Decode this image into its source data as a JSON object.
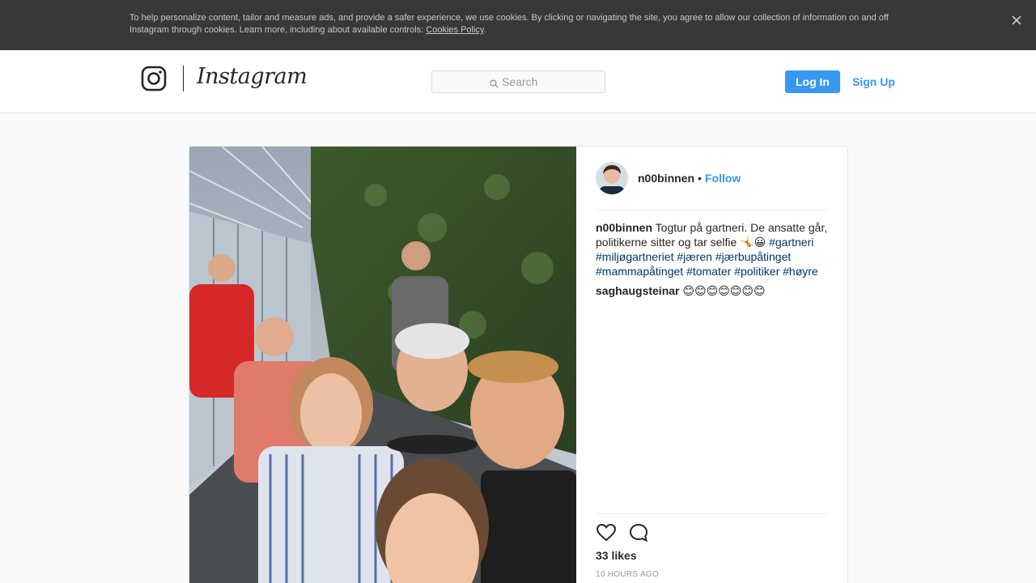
{
  "cookie_banner": {
    "text": "To help personalize content, tailor and measure ads, and provide a safer experience, we use cookies. By clicking or navigating the site, you agree to allow our collection of information on and off Instagram through cookies. Learn more, including about available controls: ",
    "link_label": "Cookies Policy",
    "trailing": ".",
    "close_icon": "close-icon"
  },
  "header": {
    "logo_text": "Instagram",
    "logo_icon": "instagram-glyph-icon",
    "search_placeholder": "Search",
    "login_label": "Log In",
    "signup_label": "Sign Up"
  },
  "post": {
    "author": "n00binnen",
    "separator": "•",
    "follow_label": "Follow",
    "caption_user": "n00binnen",
    "caption_text": " Togtur på gartneri. De ansatte går, politikerne sitter og tar selfie 🤸😀 ",
    "hashtags": [
      "#gartneri",
      "#miljøgartneriet",
      "#jæren",
      "#jærbupåtinget",
      "#mammapåtinget",
      "#tomater",
      "#politiker",
      "#høyre"
    ],
    "comment": {
      "user": "saghaugsteinar",
      "text": " 😊😊😊😊😊😊😊"
    },
    "likes": "33 likes",
    "time": "10 HOURS AGO",
    "like_icon": "heart-icon",
    "comment_icon": "speech-bubble-icon"
  },
  "colors": {
    "accent": "#3897f0",
    "hashtag": "#003569",
    "banner_bg": "#383838"
  }
}
